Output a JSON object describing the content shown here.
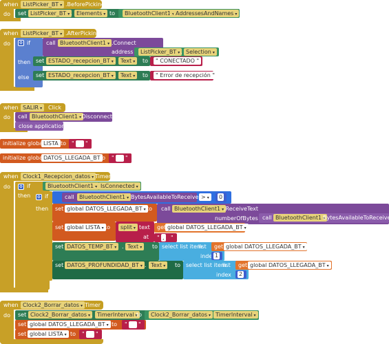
{
  "kw": {
    "when": "when",
    "do": "do",
    "if": "if",
    "then": "then",
    "else": "else",
    "set": "set",
    "to": "to",
    "call": "call",
    "address": "address",
    "initialize_global": "initialize global",
    "close_application": "close application",
    "split": "split",
    "text": "text",
    "at": "at",
    "select_list_item": "select list item",
    "list": "list",
    "index": "index",
    "get": "get",
    "numberOfBytes": "numberOfBytes",
    "gt": ">",
    "q": "\" \""
  },
  "b1": {
    "comp": "ListPicker_BT",
    "event": ".BeforePicking",
    "set_comp": "ListPicker_BT",
    "set_prop": "Elements",
    "rhs_comp": "BluetoothClient1",
    "rhs_prop": "AddressesAndNames"
  },
  "b2": {
    "comp": "ListPicker_BT",
    "event": ".AfterPicking",
    "call_comp": "BluetoothClient1",
    "call_method": ".Connect",
    "addr_comp": "ListPicker_BT",
    "addr_prop": "Selection",
    "then_comp": "ESTADO_recepcion_BT",
    "then_prop": "Text",
    "then_val": "CONECTADO",
    "else_comp": "ESTADO_recepcion_BT",
    "else_prop": "Text",
    "else_val": "Error de recepción"
  },
  "b3": {
    "comp": "SALIR",
    "event": "Click",
    "call_comp": "BluetoothClient1",
    "call_method": ".Disconnect"
  },
  "g1": {
    "name": "LISTA"
  },
  "g2": {
    "name": "DATOS_LLEGADA_BT"
  },
  "b4": {
    "comp": "Clock1_Recepcion_datos",
    "event": "Timer",
    "cond_comp": "BluetoothClient1",
    "cond_prop": "IsConnected",
    "cmp_comp": "BluetoothClient1",
    "cmp_prop": "BytesAvailableToReceive",
    "cmp_op": ">",
    "cmp_val": "0",
    "s1_var": "global DATOS_LLEGADA_BT",
    "s1_call_comp": "BluetoothClient1",
    "s1_call_method": ".ReceiveText",
    "s1_bytes_comp": "BluetoothClient1",
    "s1_bytes_prop": "BytesAvailableToReceive",
    "s2_var": "global LISTA",
    "s2_get": "global DATOS_LLEGADA_BT",
    "s3_comp": "DATOS_TEMP_BT",
    "s3_prop": "Text",
    "s3_get": "global DATOS_LLEGADA_BT",
    "s3_index": "1",
    "s4_comp": "DATOS_PROFUNDIDAD_BT",
    "s4_prop": "Text",
    "s4_get": "global DATOS_LLEGADA_BT",
    "s4_index": "2"
  },
  "b5": {
    "comp": "Clock2_Borrar_datos",
    "event": "Timer",
    "s1_comp": "Clock2_Borrar_datos",
    "s1_prop": "TimerInterval",
    "s1_rhs_comp": "Clock2_Borrar_datos",
    "s1_rhs_prop": "TimerInterval",
    "s2_var": "global DATOS_LLEGADA_BT",
    "s3_var": "global LISTA"
  }
}
